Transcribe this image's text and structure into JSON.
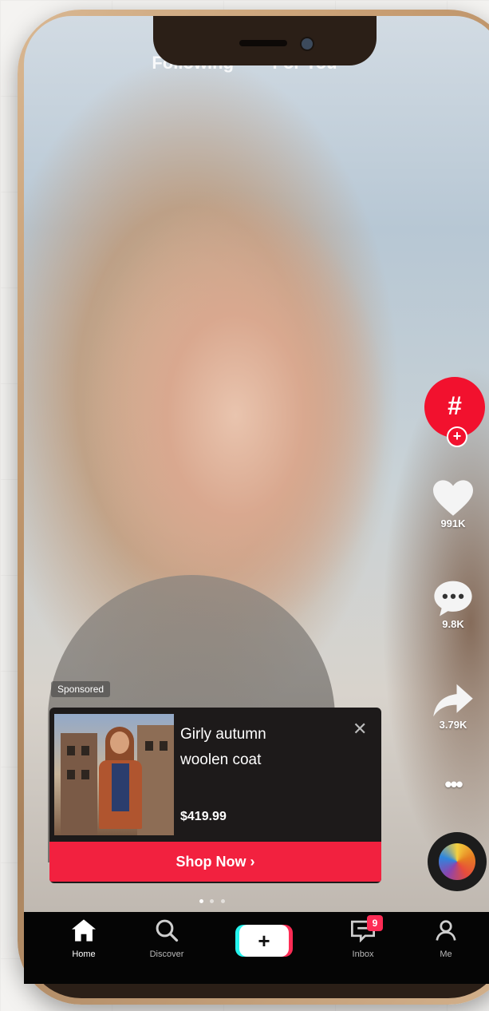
{
  "top_tabs": [
    "Following",
    "For You"
  ],
  "side_actions": {
    "hashtag_label": "#",
    "hashtag_plus": "+",
    "likes": "991K",
    "comments": "9.8K",
    "shares": "3.79K",
    "more": "•••"
  },
  "ad": {
    "sponsored": "Sponsored",
    "title_line1": "Girly autumn",
    "title_line2": "woolen coat",
    "price": "$419.99",
    "close": "✕",
    "cta": "Shop Now ›",
    "carousel_pages": 3,
    "carousel_active": 1
  },
  "bottom_nav": {
    "home": "Home",
    "discover": "Discover",
    "create": "+",
    "inbox": "Inbox",
    "inbox_badge": "9",
    "me": "Me"
  },
  "colors": {
    "accent": "#fe2c55",
    "shop_button": "#f2213f",
    "hashtag_bg": "#f2112e",
    "nav_bg": "#050505",
    "phone_frame": "#c79d72"
  },
  "icons": [
    "heart-icon",
    "comment-icon",
    "share-icon",
    "home-icon",
    "search-icon",
    "inbox-icon",
    "profile-icon",
    "music-disc-icon"
  ]
}
